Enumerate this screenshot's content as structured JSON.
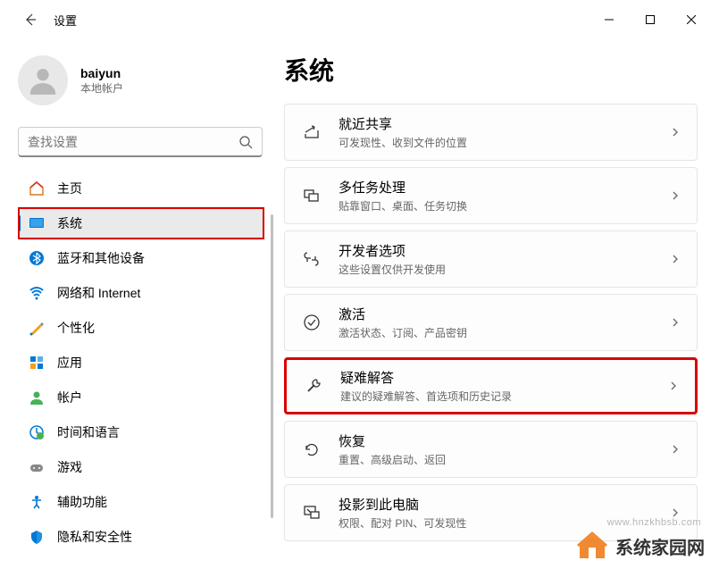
{
  "window": {
    "title": "设置"
  },
  "user": {
    "name": "baiyun",
    "subtitle": "本地帐户"
  },
  "search": {
    "placeholder": "查找设置"
  },
  "nav": [
    {
      "id": "home",
      "label": "主页"
    },
    {
      "id": "system",
      "label": "系统",
      "selected": true
    },
    {
      "id": "bluetooth",
      "label": "蓝牙和其他设备"
    },
    {
      "id": "network",
      "label": "网络和 Internet"
    },
    {
      "id": "personalization",
      "label": "个性化"
    },
    {
      "id": "apps",
      "label": "应用"
    },
    {
      "id": "accounts",
      "label": "帐户"
    },
    {
      "id": "time-language",
      "label": "时间和语言"
    },
    {
      "id": "gaming",
      "label": "游戏"
    },
    {
      "id": "accessibility",
      "label": "辅助功能"
    },
    {
      "id": "privacy",
      "label": "隐私和安全性"
    }
  ],
  "main": {
    "title": "系统",
    "items": [
      {
        "id": "nearby-share",
        "title": "就近共享",
        "sub": "可发现性、收到文件的位置"
      },
      {
        "id": "multitasking",
        "title": "多任务处理",
        "sub": "贴靠窗口、桌面、任务切换"
      },
      {
        "id": "developer",
        "title": "开发者选项",
        "sub": "这些设置仅供开发使用"
      },
      {
        "id": "activation",
        "title": "激活",
        "sub": "激活状态、订阅、产品密钥"
      },
      {
        "id": "troubleshoot",
        "title": "疑难解答",
        "sub": "建议的疑难解答、首选项和历史记录",
        "highlight": true
      },
      {
        "id": "recovery",
        "title": "恢复",
        "sub": "重置、高级启动、返回"
      },
      {
        "id": "project",
        "title": "投影到此电脑",
        "sub": "权限、配对 PIN、可发现性"
      }
    ]
  },
  "watermark": {
    "text": "系统家园网",
    "url": "www.hnzkhbsb.com"
  }
}
